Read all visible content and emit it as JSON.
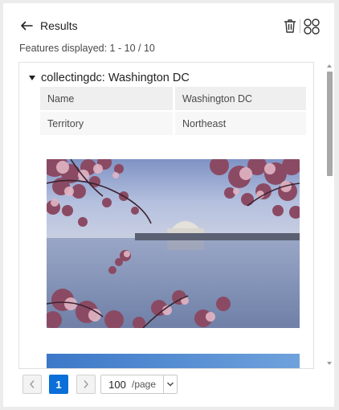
{
  "header": {
    "title": "Results"
  },
  "features_count": "Features displayed: 1 - 10 / 10",
  "feature": {
    "title": "collectingdc: Washington DC",
    "attributes": [
      {
        "key": "Name",
        "value": "Washington DC"
      },
      {
        "key": "Territory",
        "value": "Northeast"
      }
    ]
  },
  "pagination": {
    "current_page": "1",
    "page_size": "100",
    "page_size_label": "/page"
  },
  "colors": {
    "accent": "#0a6fd8",
    "blossom": "#c8859a",
    "sky": "#9fb2d6",
    "water": "#8798b9"
  },
  "icons": [
    "back-arrow-icon",
    "trash-icon",
    "grid-icon",
    "chevron-left-icon",
    "chevron-right-icon",
    "chevron-down-icon",
    "caret-down-icon"
  ]
}
